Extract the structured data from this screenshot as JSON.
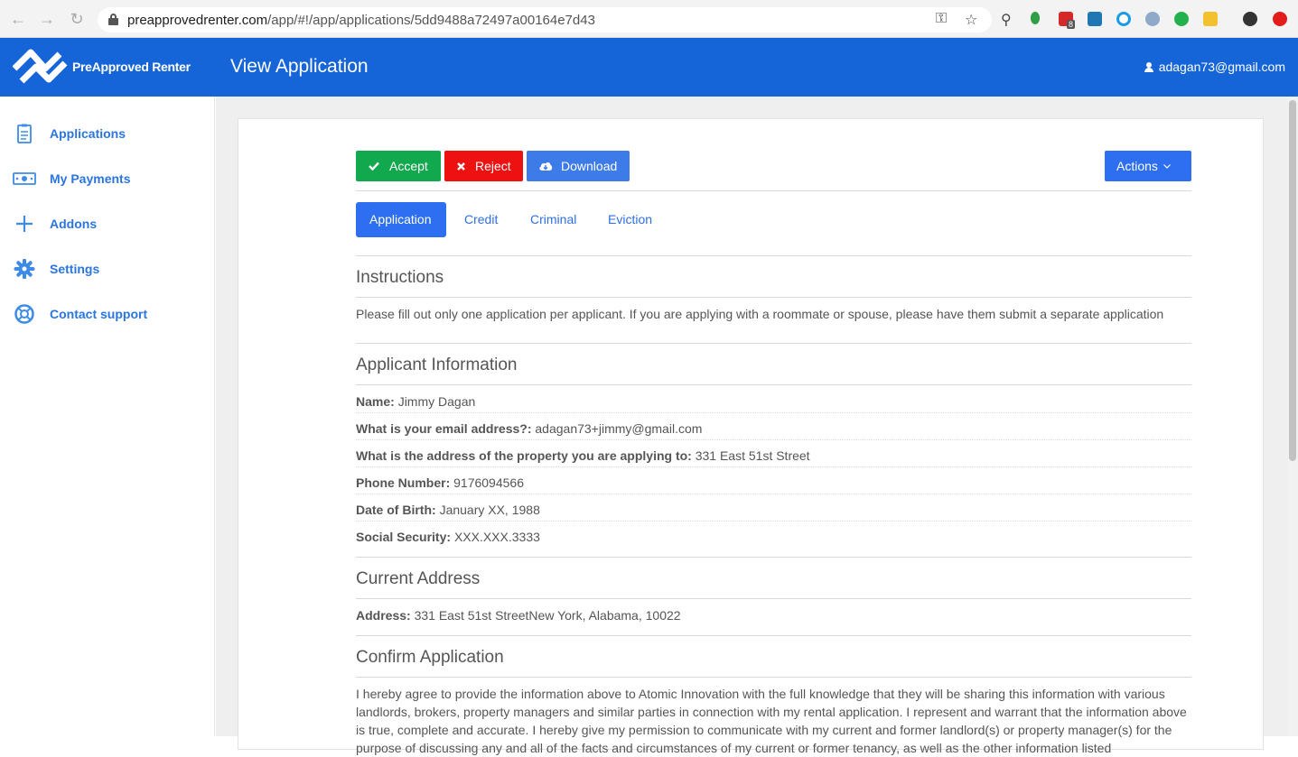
{
  "browser": {
    "url_host": "preapprovedrenter.com",
    "url_path": "/app/#!/app/applications/5dd9488a72497a00164e7d43",
    "extension_badge": "8",
    "icons": [
      "back-arrow-icon",
      "forward-arrow-icon",
      "reload-icon",
      "lock-icon",
      "key-icon",
      "star-icon",
      "search-icon"
    ]
  },
  "header": {
    "logo_text": "PreApproved Renter",
    "title": "View Application",
    "user_email": "adagan73@gmail.com"
  },
  "sidebar": {
    "items": [
      {
        "label": "Applications",
        "icon": "clipboard-icon"
      },
      {
        "label": "My Payments",
        "icon": "money-icon"
      },
      {
        "label": "Addons",
        "icon": "plus-icon"
      },
      {
        "label": "Settings",
        "icon": "gear-icon"
      },
      {
        "label": "Contact support",
        "icon": "lifebuoy-icon"
      }
    ]
  },
  "toolbar": {
    "accept_label": "Accept",
    "reject_label": "Reject",
    "download_label": "Download",
    "actions_label": "Actions"
  },
  "tabs": [
    {
      "label": "Application"
    },
    {
      "label": "Credit"
    },
    {
      "label": "Criminal"
    },
    {
      "label": "Eviction"
    }
  ],
  "instructions": {
    "title": "Instructions",
    "text": "Please fill out only one application per applicant. If you are applying with a roommate or spouse, please have them submit a separate application"
  },
  "applicant": {
    "title": "Applicant Information",
    "fields": [
      {
        "label": "Name:",
        "value": "Jimmy Dagan"
      },
      {
        "label": "What is your email address?:",
        "value": "adagan73+jimmy@gmail.com"
      },
      {
        "label": "What is the address of the property you are applying to:",
        "value": " 331 East 51st Street"
      },
      {
        "label": "Phone Number:",
        "value": "9176094566"
      },
      {
        "label": "Date of Birth:",
        "value": "January XX, 1988"
      },
      {
        "label": "Social Security:",
        "value": "XXX.XXX.3333"
      }
    ]
  },
  "current_address": {
    "title": "Current Address",
    "label": "Address:",
    "value": " 331 East 51st StreetNew York, Alabama, 10022"
  },
  "confirm": {
    "title": "Confirm Application",
    "text": "I hereby agree to provide the information above to Atomic Innovation with the full knowledge that they will be sharing this information with various landlords, brokers, property managers and similar parties in connection with my rental application. I represent and warrant that the information above is true, complete and accurate. I hereby give my permission to communicate with my current and former landlord(s) or property manager(s) for the purpose of discussing any and all of the facts and circumstances of my current or former tenancy, as well as the other information listed"
  },
  "colors": {
    "brand_blue": "#1565d8",
    "accept_green": "#12a84d",
    "reject_red": "#ee1111",
    "primary_blue": "#2d6ff0"
  }
}
